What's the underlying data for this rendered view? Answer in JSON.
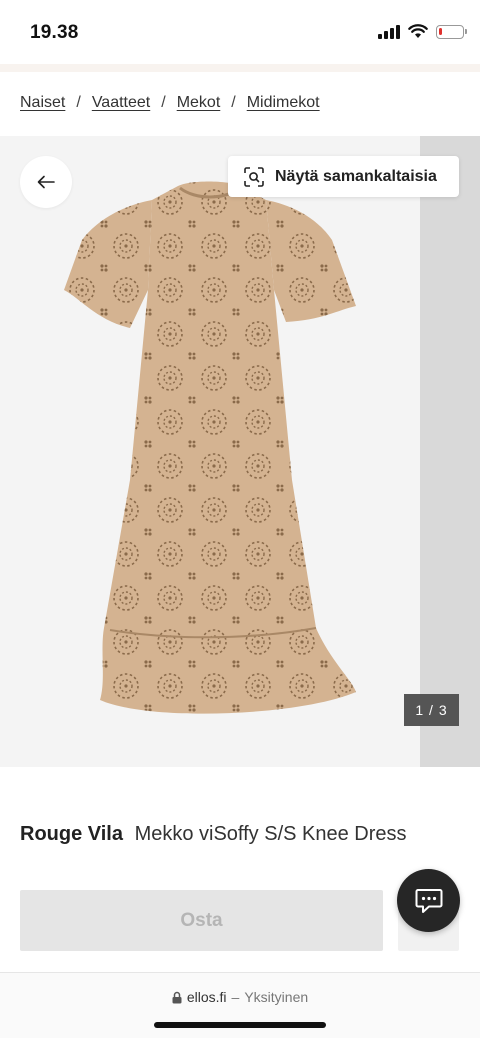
{
  "status_bar": {
    "time": "19.38",
    "battery_percent": 12,
    "battery_color": "#e0312d"
  },
  "breadcrumb": [
    "Naiset",
    "Vaatteet",
    "Mekot",
    "Midimekot"
  ],
  "breadcrumb_separator": "/",
  "gallery": {
    "similar_label": "Näytä samankaltaisia",
    "counter": "1 / 3",
    "image_subject": "dress",
    "dress_color": "#d4b391"
  },
  "product": {
    "brand": "Rouge Vila",
    "name": "Mekko viSoffy S/S Knee Dress"
  },
  "actions": {
    "buy_label": "Osta"
  },
  "url_bar": {
    "domain": "ellos.fi",
    "separator": "–",
    "mode": "Yksityinen"
  }
}
